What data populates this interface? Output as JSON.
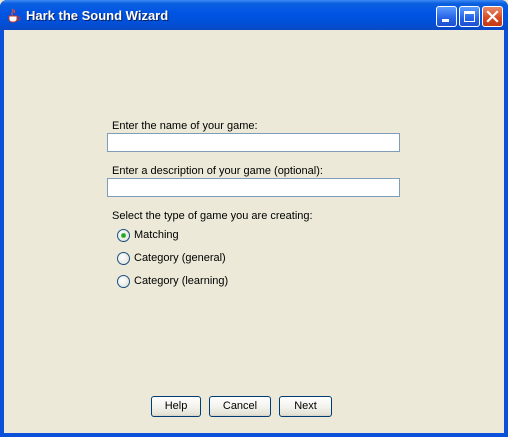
{
  "window": {
    "title": "Hark the Sound Wizard"
  },
  "form": {
    "name_label": "Enter the name of your game:",
    "name_value": "",
    "description_label": "Enter a description of your game (optional):",
    "description_value": "",
    "type_label": "Select the type of game you are creating:",
    "options": [
      {
        "label": "Matching",
        "selected": true
      },
      {
        "label": "Category (general)",
        "selected": false
      },
      {
        "label": "Category (learning)",
        "selected": false
      }
    ]
  },
  "buttons": {
    "help": "Help",
    "cancel": "Cancel",
    "next": "Next"
  },
  "colors": {
    "titlebar": "#0054e3",
    "client": "#ece9d8",
    "radio_selected": "#21a121"
  }
}
